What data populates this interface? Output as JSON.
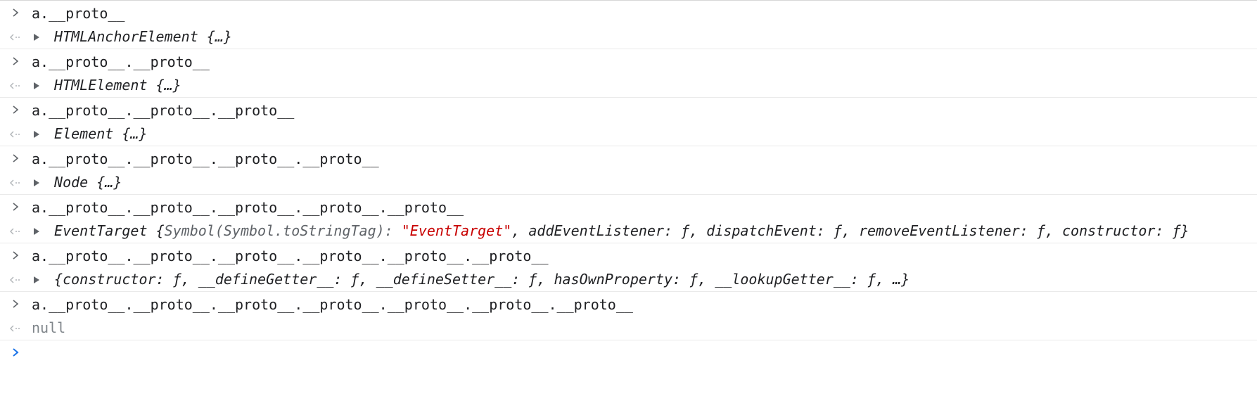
{
  "entries": [
    {
      "input": "a.__proto__",
      "result": {
        "name": "HTMLAnchorElement",
        "preview": "{…}"
      }
    },
    {
      "input": "a.__proto__.__proto__",
      "result": {
        "name": "HTMLElement",
        "preview": "{…}"
      }
    },
    {
      "input": "a.__proto__.__proto__.__proto__",
      "result": {
        "name": "Element",
        "preview": "{…}"
      }
    },
    {
      "input": "a.__proto__.__proto__.__proto__.__proto__",
      "result": {
        "name": "Node",
        "preview": "{…}"
      }
    },
    {
      "input": "a.__proto__.__proto__.__proto__.__proto__.__proto__",
      "result": {
        "name": "EventTarget",
        "open": "{",
        "key1": "Symbol(Symbol.toStringTag): ",
        "str1": "\"EventTarget\"",
        "rest": ", addEventListener: ƒ, dispatchEvent: ƒ, removeEventListener: ƒ, constructor: ƒ}"
      }
    },
    {
      "input": "a.__proto__.__proto__.__proto__.__proto__.__proto__.__proto__",
      "result": {
        "text": "{constructor: ƒ, __defineGetter__: ƒ, __defineSetter__: ƒ, hasOwnProperty: ƒ, __lookupGetter__: ƒ, …}"
      }
    },
    {
      "input": "a.__proto__.__proto__.__proto__.__proto__.__proto__.__proto__.__proto__",
      "result": {
        "null_text": "null"
      }
    }
  ],
  "colors": {
    "prompt": "#5f6368",
    "active_prompt": "#1a73e8",
    "string": "#c80000",
    "null": "#80868b"
  },
  "icons": {
    "input_prompt": "chevron-right-icon",
    "result_arrow": "return-arrow-icon",
    "expander": "triangle-right-icon"
  }
}
